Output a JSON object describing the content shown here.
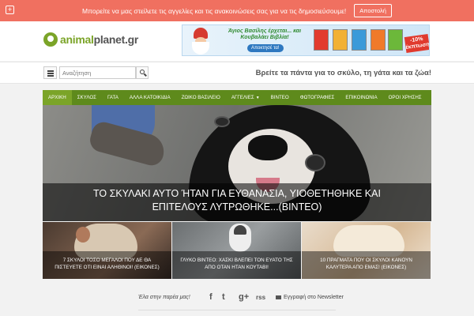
{
  "topbar": {
    "message": "Μπορείτε να μας στείλετε τις αγγελίες και τις ανακοινώσεις σας για να τις δημοσιεύσουμε!",
    "button": "Αποστολή",
    "icon": "plus-square-icon"
  },
  "header": {
    "logo_part1": "animal",
    "logo_part2": "planet.gr",
    "logo_icon": "globe-leaf-icon"
  },
  "banner": {
    "title": "Άγιος Βασίλης έρχεται... και Κουβαλάει Βιβλία!",
    "button": "Αποκτησέ τα!",
    "badge": "-10% έκπτωση",
    "book_colors": [
      "#e23b2e",
      "#f2b134",
      "#3a9ad9",
      "#f07a2a",
      "#6cb83a"
    ]
  },
  "search": {
    "placeholder": "Αναζήτηση",
    "menu_icon": "hamburger-icon",
    "search_icon": "magnifier-icon"
  },
  "tagline": "Βρείτε τα πάντα για το σκύλο, τη γάτα και τα ζώα!",
  "nav": {
    "items": [
      "ΑΡΧΙΚΗ",
      "ΣΚΥΛΟΣ",
      "ΓΑΤΑ",
      "ΑΛΛΑ ΚΑΤΟΙΚΙΔΙΑ",
      "ΖΩΙΚΟ ΒΑΣΙΛΕΙΟ",
      "ΑΓΓΕΛΙΕΣ",
      "ΒΙΝΤΕΟ",
      "ΦΩΤΟΓΡΑΦΙΕΣ",
      "ΕΠΙΚΟΙΝΩΝΙΑ",
      "ΟΡΟΙ ΧΡΗΣΗΣ"
    ],
    "dropdown_caret": "▼"
  },
  "hero": {
    "caption": "ΤΟ ΣΚΥΛΑΚΙ ΑΥΤΟ ΉΤΑΝ ΓΙΑ ΕΥΘΑΝΑΣΙΑ, ΥΙΟΘΕΤΗΘΗΚΕ ΚΑΙ ΕΠΙΤΕΛΟΥΣ ΛΥΤΡΩΘΗΚΕ...(ΒΙΝΤΕΟ)"
  },
  "thumbs": [
    {
      "caption": "7 ΣΚΥΛΟΙ ΤΟΣΟ ΜΕΓΑΛΟΙ ΠΟΥ ΔΕ ΘΑ ΠΙΣΤΕΥΕΤΕ ΟΤΙ ΕΙΝΑΙ ΑΛΗΘΙΝΟΙ! (ΕΙΚΟΝΕΣ)"
    },
    {
      "caption": "ΓΛΥΚΟ ΒΙΝΤΕΟ: ΧΑΣΚΙ ΒΛΕΠΕΙ ΤΟΝ ΕΥΑΤΟ ΤΗΣ ΑΠΟ ΟΤΑΝ ΗΤΑΝ ΚΟΥΤΑΒΙ!"
    },
    {
      "caption": "10 ΠΡΑΓΜΑΤΑ ΠΟΥ ΟΙ ΣΚΥΛΟΙ ΚΑΝΟΥΝ ΚΑΛΥΤΕΡΑ ΑΠΟ ΕΜΑΣ! (ΕΙΚΟΝΕΣ)"
    }
  ],
  "social": {
    "join": "Έλα στην παρέα μας!",
    "facebook": "f",
    "twitter": "t",
    "googleplus": "g+",
    "rss": "rss",
    "newsletter": "Εγγραφή στο Newsletter"
  }
}
